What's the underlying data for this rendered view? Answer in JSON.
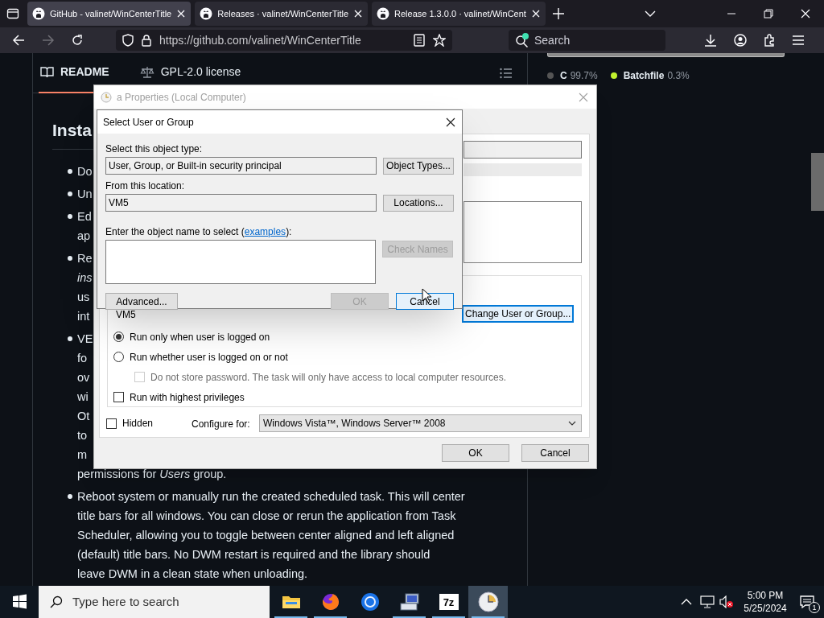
{
  "browser": {
    "tabs": [
      {
        "title": "GitHub - valinet/WinCenterTitle",
        "selected": true
      },
      {
        "title": "Releases · valinet/WinCenterTitle",
        "selected": false
      },
      {
        "title": "Release 1.3.0.0 · valinet/WinCent",
        "selected": false
      }
    ],
    "url": "https://github.com/valinet/WinCenterTitle",
    "search": {
      "placeholder": "Search"
    }
  },
  "readme": {
    "tabs": [
      {
        "label": "README",
        "selected": true
      },
      {
        "label": "GPL-2.0 license",
        "selected": false
      }
    ],
    "heading": "Insta",
    "items": [
      {
        "lines": [
          "Do"
        ]
      },
      {
        "lines": [
          "Un"
        ]
      },
      {
        "lines": [
          "Ed",
          "ap"
        ]
      },
      {
        "lines": [
          "Re",
          "*ins*",
          "us",
          "int"
        ]
      },
      {
        "lines": [
          "VE",
          "fo",
          "ov",
          "wi",
          "Ot",
          "to",
          "m",
          "permissions for *Users* group."
        ]
      },
      {
        "lines": [
          "Reboot system or manually run the created scheduled task. This will center",
          "title bars for all windows. You can close or rerun the application from Task",
          "Scheduler, allowing you to toggle between center aligned and left aligned",
          "(default) title bars. No DWM restart is required and the library should",
          "leave DWM in a clean state when unloading."
        ]
      }
    ]
  },
  "languages": [
    {
      "name": "C",
      "percent": "99.7%",
      "color": "#555555"
    },
    {
      "name": "Batchfile",
      "percent": "0.3%",
      "color": "#c1f12e"
    }
  ],
  "properties_dialog": {
    "title": "a Properties (Local Computer)",
    "user": "VM5",
    "change_button": "Change User or Group...",
    "options": [
      {
        "kind": "radio",
        "label": "Run only when user is logged on",
        "checked": true,
        "disabled": false
      },
      {
        "kind": "radio",
        "label": "Run whether user is logged on or not",
        "checked": false,
        "disabled": false
      },
      {
        "kind": "checkbox",
        "label": "Do not store password.  The task will only have access to local computer resources.",
        "checked": false,
        "disabled": true
      },
      {
        "kind": "checkbox",
        "label": "Run with highest privileges",
        "checked": false,
        "disabled": false
      }
    ],
    "hidden": {
      "label": "Hidden",
      "checked": false
    },
    "configure_label": "Configure for:",
    "configure_value": "Windows Vista™, Windows Server™ 2008",
    "buttons": [
      "OK",
      "Cancel"
    ]
  },
  "select_dialog": {
    "title": "Select User or Group",
    "object_type_label": "Select this object type:",
    "object_type": "User, Group, or Built-in security principal",
    "object_types_button": "Object Types...",
    "location_label": "From this location:",
    "location": "VM5",
    "locations_button": "Locations...",
    "name_label": "Enter the object name to select (",
    "name_link": "examples",
    "name_label_end": "):",
    "check_names_button": {
      "label": "Check Names",
      "disabled": true
    },
    "advanced_button": "Advanced...",
    "buttons": [
      {
        "label": "OK",
        "disabled": true
      },
      {
        "label": "Cancel",
        "disabled": false
      }
    ]
  },
  "taskbar": {
    "search": {
      "placeholder": "Type here to search"
    },
    "apps": [
      {
        "kind": "folder",
        "running": true,
        "selected": false
      },
      {
        "kind": "fox",
        "running": true,
        "selected": false
      },
      {
        "kind": "ring",
        "running": false,
        "selected": false
      },
      {
        "kind": "computer",
        "running": true,
        "selected": false
      },
      {
        "kind": "archive",
        "label": "7z",
        "running": true,
        "selected": false
      },
      {
        "kind": "clock",
        "running": true,
        "selected": true
      }
    ],
    "time": "5:00 PM",
    "date": "5/25/2024",
    "notifications": "1"
  }
}
